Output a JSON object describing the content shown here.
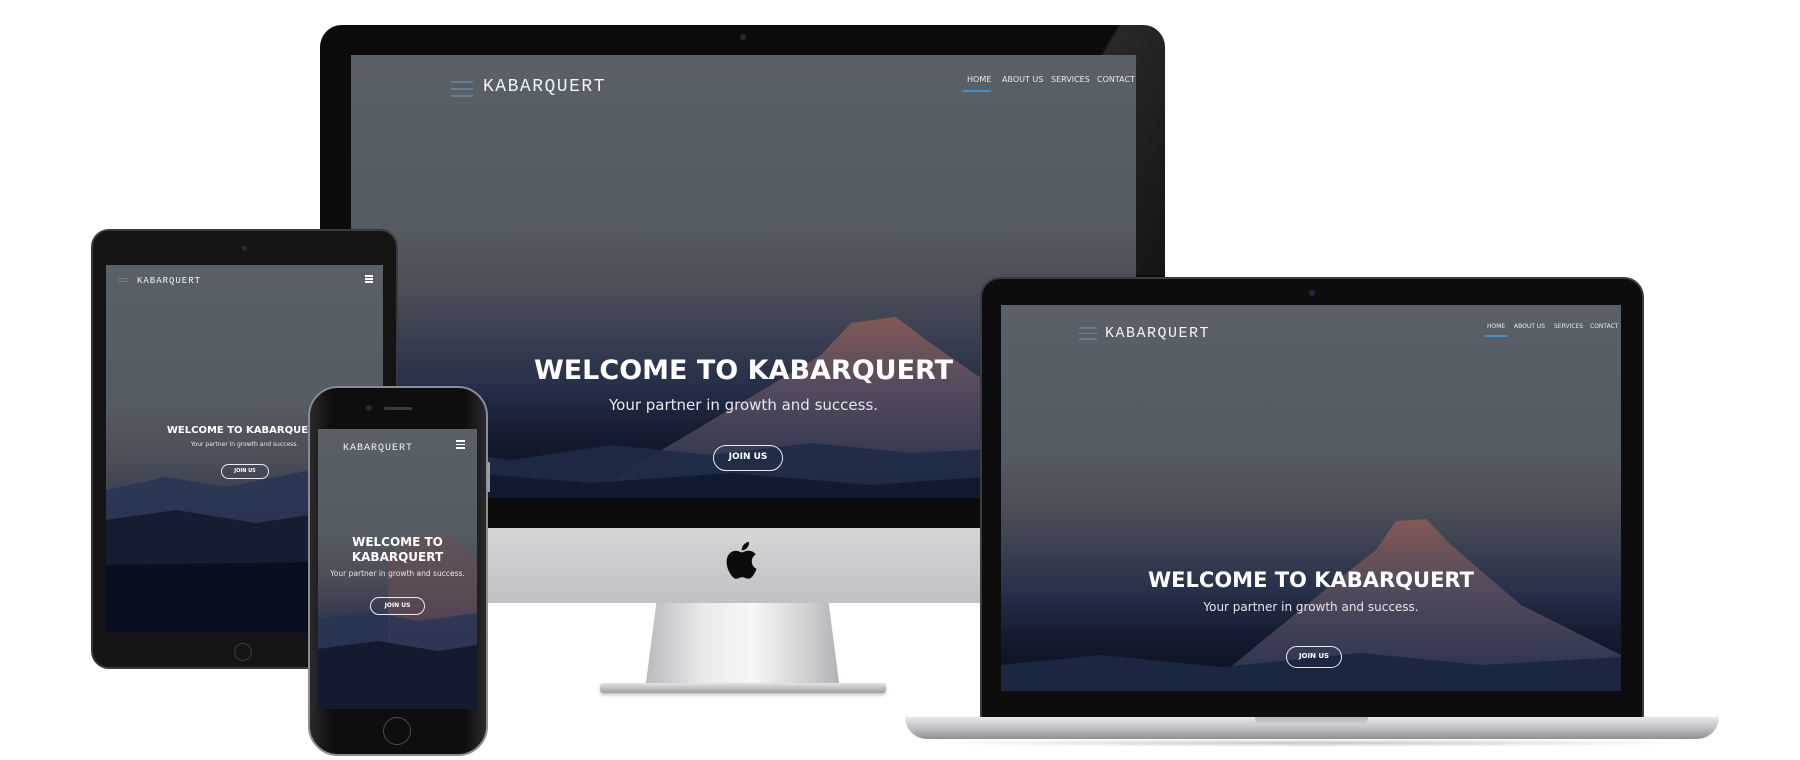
{
  "site": {
    "brand": "KABARQUERT",
    "nav": [
      "HOME",
      "ABOUT US",
      "SERVICES",
      "CONTACT U"
    ],
    "nav_active": "HOME",
    "hero_title": "WELCOME TO KABARQUERT",
    "hero_title_line1": "WELCOME TO",
    "hero_title_line2": "KABARQUERT",
    "hero_sub": "Your partner in growth and success.",
    "cta": "JOIN US",
    "menu_icon": "hamburger-menu-icon"
  },
  "devices": [
    "desktop-monitor",
    "laptop",
    "tablet",
    "phone"
  ],
  "colors": {
    "accent_underline": "#3b8fd6",
    "hero_text": "#ffffff",
    "bezel": "#0c0c0c",
    "aluminum": "#c9cbce"
  }
}
